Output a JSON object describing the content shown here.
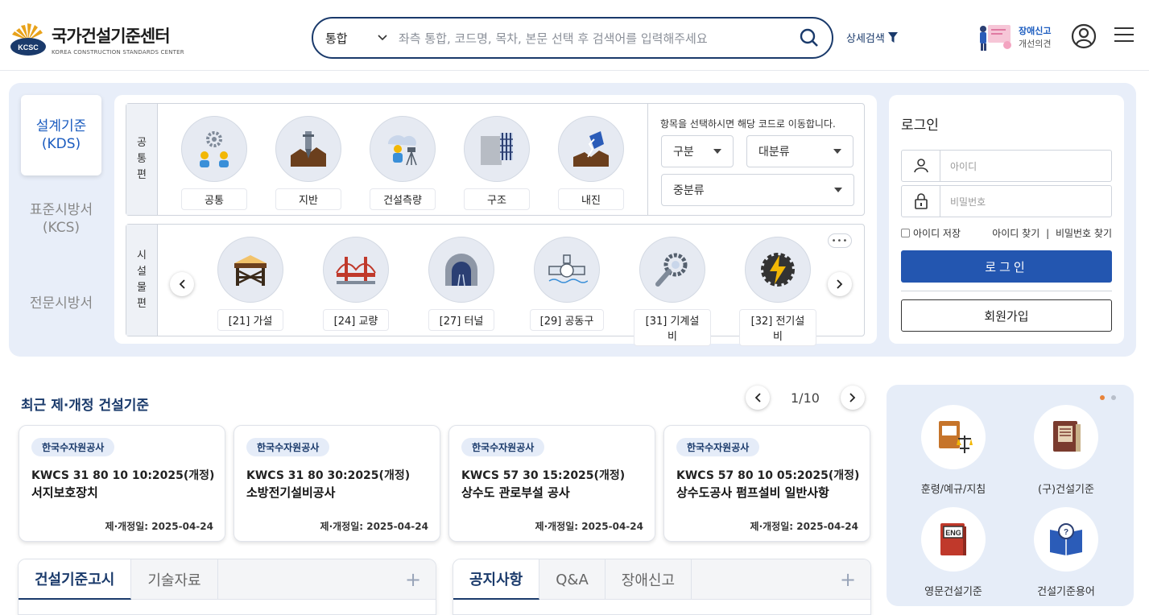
{
  "header": {
    "logo_title": "국가건설기준센터",
    "logo_sub": "KOREA CONSTRUCTION STANDARDS CENTER",
    "logo_mark_text": "KCSC",
    "search_scope": "통합",
    "search_placeholder": "좌측 통합, 코드명, 목차, 본문 선택 후 검색어를 입력해주세요",
    "advanced_search": "상세검색",
    "report_line1": "장애신고",
    "report_line2": "개선의견"
  },
  "left_tabs": [
    {
      "line1": "설계기준",
      "line2": "(KDS)"
    },
    {
      "line1": "표준시방서",
      "line2": "(KCS)"
    },
    {
      "line1": "전문시방서",
      "line2": ""
    }
  ],
  "common": {
    "label_chars": [
      "공",
      "통",
      "편"
    ],
    "items": [
      "공통",
      "지반",
      "건설측량",
      "구조",
      "내진"
    ]
  },
  "facility": {
    "label_chars": [
      "시",
      "설",
      "물",
      "편"
    ],
    "items": [
      "[21] 가설",
      "[24] 교량",
      "[27] 터널",
      "[29] 공동구",
      "[31] 기계설비",
      "[32] 전기설비"
    ],
    "more": "•••"
  },
  "selector": {
    "hint": "항목을 선택하시면 해당 코드로 이동합니다.",
    "division": "구분",
    "major": "대분류",
    "middle": "중분류"
  },
  "login": {
    "title": "로그인",
    "id_placeholder": "아이디",
    "pw_placeholder": "비밀번호",
    "remember": "아이디 저장",
    "find_id": "아이디 찾기",
    "sep": "|",
    "find_pw": "비밀번호 찾기",
    "login_btn": "로그인",
    "join_btn": "회원가입"
  },
  "recent": {
    "title": "최근 제·개정 건설기준",
    "page": "1/10",
    "cards": [
      {
        "org": "한국수자원공사",
        "code": "KWCS 31 80 10 10:2025(개정)",
        "name": "서지보호장치",
        "date": "제·개정일: 2025-04-24"
      },
      {
        "org": "한국수자원공사",
        "code": "KWCS 31 80 30:2025(개정)",
        "name": "소방전기설비공사",
        "date": "제·개정일: 2025-04-24"
      },
      {
        "org": "한국수자원공사",
        "code": "KWCS 57 30 15:2025(개정)",
        "name": "상수도 관로부설 공사",
        "date": "제·개정일: 2025-04-24"
      },
      {
        "org": "한국수자원공사",
        "code": "KWCS 57 80 10 05:2025(개정)",
        "name": "상수도공사 펌프설비 일반사항",
        "date": "제·개정일: 2025-04-24"
      }
    ]
  },
  "quick": {
    "items": [
      "훈령/예규/지침",
      "(구)건설기준",
      "영문건설기준",
      "건설기준용어"
    ],
    "eng_badge": "ENG"
  },
  "bottom_tabs": {
    "left": [
      "건설기준고시",
      "기술자료"
    ],
    "right": [
      "공지사항",
      "Q&A",
      "장애신고"
    ],
    "plus": "+"
  },
  "colors": {
    "primary": "#1a3a6b",
    "accent": "#2356b0",
    "band": "#e8eef9"
  }
}
